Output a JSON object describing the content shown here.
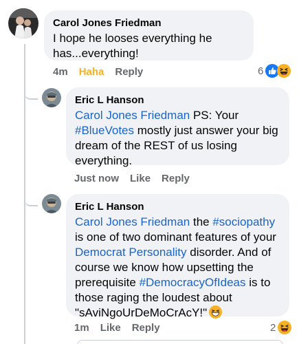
{
  "comments": [
    {
      "author": "Carol Jones Friedman",
      "text": "I hope he looses everything he has...everything!",
      "time": "4m",
      "reaction_label": "Haha",
      "reply_label": "Reply",
      "reaction_count": "6",
      "reaction_icons": [
        "like-icon",
        "haha-icon"
      ]
    },
    {
      "author": "Eric L Hanson",
      "mention": "Carol Jones Friedman",
      "text_1": " PS: Your ",
      "hashtag": "#BlueVotes",
      "text_2": " mostly just answer your big dream of the REST of us losing everything.",
      "time": "Just now",
      "like_label": "Like",
      "reply_label": "Reply"
    },
    {
      "author": "Eric L Hanson",
      "mention": "Carol Jones Friedman",
      "text_1": " the ",
      "hashtag_1": "#sociopathy",
      "text_2": " is one of two dominant features of your ",
      "link_text": "Democrat Personality",
      "text_3": " disorder.  And of course we know how upsetting the prerequisite ",
      "hashtag_2": "#DemocracyOfIdeas",
      "text_4": " is to those raging the loudest about \"sAviNgoUrDeMoCrAcY!\"",
      "inline_emoji": "grinning-squint-icon",
      "time": "1m",
      "like_label": "Like",
      "reply_label": "Reply",
      "reaction_count": "2",
      "reaction_icons": [
        "haha-icon"
      ]
    }
  ],
  "colors": {
    "bubble": "#f0f2f5",
    "link": "#1b64c8",
    "muted": "#65676b",
    "haha": "#f7b125",
    "like_blue": "#1877f2",
    "thread_line": "#ccd0d5"
  }
}
